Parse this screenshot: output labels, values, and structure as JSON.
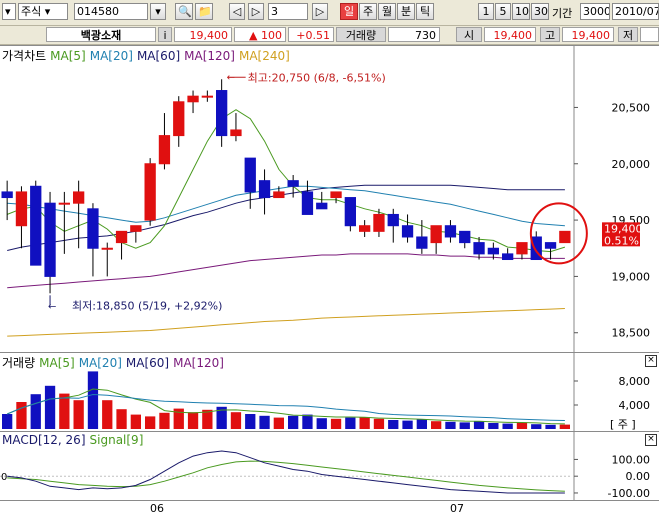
{
  "toolbar": {
    "market": "주식",
    "code": "014580",
    "count": "3",
    "periods": [
      "일",
      "주",
      "월",
      "분",
      "틱"
    ],
    "nums": [
      "1",
      "5",
      "10",
      "30"
    ],
    "period_label": "기간",
    "period_value": "3000",
    "date": "2010/07/"
  },
  "info": {
    "name": "백광소재",
    "i": "i",
    "price": "19,400",
    "change": "▲ 100",
    "rate": "+0.51",
    "vol_label": "거래량",
    "vol_value": "730",
    "open_label": "시",
    "open_value": "19,400",
    "high_label": "고",
    "high_value": "19,400",
    "low_label": "저"
  },
  "price_pane": {
    "title": "가격차트",
    "mas": [
      {
        "label": "MA[5]",
        "color": "#4a9a20"
      },
      {
        "label": "MA[20]",
        "color": "#2080b0"
      },
      {
        "label": "MA[60]",
        "color": "#1a1a6a"
      },
      {
        "label": "MA[120]",
        "color": "#7a1a7a"
      },
      {
        "label": "MA[240]",
        "color": "#d0a020"
      }
    ],
    "y_ticks": [
      "20,500",
      "20,000",
      "19,500",
      "19,000",
      "18,500"
    ],
    "high_note": "최고:20,750 (6/8, -6,51%)",
    "low_note": "최저:18,850 (5/19, +2,92%)",
    "last_price": "19,400",
    "last_rate": "0.51%"
  },
  "volume_pane": {
    "title": "거래량",
    "mas": [
      {
        "label": "MA[5]",
        "color": "#4a9a20"
      },
      {
        "label": "MA[20]",
        "color": "#2080b0"
      },
      {
        "label": "MA[60]",
        "color": "#1a1a6a"
      },
      {
        "label": "MA[120]",
        "color": "#7a1a7a"
      }
    ],
    "y_ticks": [
      "8,000",
      "4,000"
    ],
    "unit": "[ 주 ]"
  },
  "macd_pane": {
    "title": "MACD[12, 26]",
    "signal": "Signal[9]",
    "left_tick": "0",
    "y_ticks": [
      "100.00",
      "0.00",
      "-100.00"
    ]
  },
  "x_axis": {
    "labels": [
      "06",
      "07"
    ]
  },
  "colors": {
    "up": "#e01010",
    "down": "#1010c0"
  },
  "chart_data": {
    "type": "candlestick",
    "candles": [
      {
        "o": 19750,
        "h": 19850,
        "l": 19500,
        "c": 19700
      },
      {
        "o": 19450,
        "h": 19800,
        "l": 19250,
        "c": 19750
      },
      {
        "o": 19800,
        "h": 19850,
        "l": 19150,
        "c": 19100
      },
      {
        "o": 19650,
        "h": 19750,
        "l": 18850,
        "c": 19000
      },
      {
        "o": 19650,
        "h": 19750,
        "l": 19200,
        "c": 19650
      },
      {
        "o": 19650,
        "h": 19850,
        "l": 19250,
        "c": 19750
      },
      {
        "o": 19600,
        "h": 19650,
        "l": 19000,
        "c": 19250
      },
      {
        "o": 19250,
        "h": 19300,
        "l": 19000,
        "c": 19250
      },
      {
        "o": 19300,
        "h": 19400,
        "l": 19150,
        "c": 19400
      },
      {
        "o": 19400,
        "h": 19450,
        "l": 19300,
        "c": 19450
      },
      {
        "o": 19500,
        "h": 20050,
        "l": 19450,
        "c": 20000
      },
      {
        "o": 20000,
        "h": 20450,
        "l": 19950,
        "c": 20250
      },
      {
        "o": 20250,
        "h": 20600,
        "l": 20150,
        "c": 20550
      },
      {
        "o": 20550,
        "h": 20650,
        "l": 20450,
        "c": 20600
      },
      {
        "o": 20600,
        "h": 20650,
        "l": 20550,
        "c": 20600
      },
      {
        "o": 20650,
        "h": 20750,
        "l": 20150,
        "c": 20250
      },
      {
        "o": 20250,
        "h": 20450,
        "l": 20200,
        "c": 20300
      },
      {
        "o": 20050,
        "h": 20050,
        "l": 19600,
        "c": 19750
      },
      {
        "o": 19850,
        "h": 19950,
        "l": 19550,
        "c": 19700
      },
      {
        "o": 19700,
        "h": 19800,
        "l": 19700,
        "c": 19750
      },
      {
        "o": 19850,
        "h": 19900,
        "l": 19700,
        "c": 19800
      },
      {
        "o": 19750,
        "h": 19850,
        "l": 19550,
        "c": 19550
      },
      {
        "o": 19650,
        "h": 19750,
        "l": 19600,
        "c": 19600
      },
      {
        "o": 19700,
        "h": 19750,
        "l": 19650,
        "c": 19750
      },
      {
        "o": 19700,
        "h": 19700,
        "l": 19400,
        "c": 19450
      },
      {
        "o": 19400,
        "h": 19500,
        "l": 19350,
        "c": 19450
      },
      {
        "o": 19400,
        "h": 19600,
        "l": 19350,
        "c": 19550
      },
      {
        "o": 19550,
        "h": 19600,
        "l": 19300,
        "c": 19450
      },
      {
        "o": 19450,
        "h": 19550,
        "l": 19300,
        "c": 19350
      },
      {
        "o": 19350,
        "h": 19500,
        "l": 19200,
        "c": 19250
      },
      {
        "o": 19300,
        "h": 19450,
        "l": 19200,
        "c": 19450
      },
      {
        "o": 19450,
        "h": 19500,
        "l": 19300,
        "c": 19350
      },
      {
        "o": 19400,
        "h": 19400,
        "l": 19250,
        "c": 19300
      },
      {
        "o": 19300,
        "h": 19350,
        "l": 19150,
        "c": 19200
      },
      {
        "o": 19250,
        "h": 19300,
        "l": 19150,
        "c": 19200
      },
      {
        "o": 19200,
        "h": 19250,
        "l": 19150,
        "c": 19150
      },
      {
        "o": 19200,
        "h": 19300,
        "l": 19150,
        "c": 19300
      },
      {
        "o": 19350,
        "h": 19400,
        "l": 19150,
        "c": 19150
      },
      {
        "o": 19300,
        "h": 19300,
        "l": 19150,
        "c": 19250
      },
      {
        "o": 19300,
        "h": 19400,
        "l": 19300,
        "c": 19400
      }
    ],
    "volume": [
      2500,
      4500,
      5800,
      7200,
      5900,
      4800,
      9600,
      4800,
      3300,
      2400,
      2100,
      2700,
      3400,
      2800,
      3200,
      3700,
      2800,
      2500,
      2200,
      1900,
      2200,
      2400,
      1800,
      1700,
      1900,
      2000,
      1700,
      1500,
      1400,
      1600,
      1300,
      1200,
      1100,
      1300,
      1000,
      900,
      1100,
      800,
      700,
      730
    ],
    "ma5": [
      19550,
      19600,
      19620,
      19480,
      19400,
      19450,
      19500,
      19420,
      19300,
      19250,
      19300,
      19450,
      19700,
      19950,
      20200,
      20400,
      20480,
      20400,
      20200,
      19950,
      19800,
      19700,
      19680,
      19680,
      19640,
      19600,
      19570,
      19530,
      19480,
      19450,
      19400,
      19390,
      19360,
      19330,
      19320,
      19260,
      19250,
      19230,
      19220,
      19260
    ],
    "ma20": [
      19650,
      19640,
      19620,
      19600,
      19580,
      19560,
      19540,
      19520,
      19500,
      19480,
      19490,
      19520,
      19560,
      19600,
      19640,
      19680,
      19720,
      19740,
      19760,
      19780,
      19800,
      19800,
      19790,
      19780,
      19770,
      19760,
      19740,
      19720,
      19700,
      19680,
      19660,
      19640,
      19610,
      19580,
      19550,
      19520,
      19490,
      19470,
      19460,
      19450
    ],
    "ma60": [
      19230,
      19260,
      19280,
      19300,
      19320,
      19340,
      19350,
      19360,
      19380,
      19400,
      19430,
      19460,
      19500,
      19540,
      19570,
      19610,
      19650,
      19680,
      19700,
      19720,
      19740,
      19760,
      19780,
      19790,
      19800,
      19810,
      19810,
      19810,
      19810,
      19810,
      19810,
      19810,
      19800,
      19790,
      19780,
      19770,
      19770,
      19770,
      19770,
      19770
    ],
    "ma120": [
      18900,
      18910,
      18920,
      18930,
      18940,
      18950,
      18960,
      18970,
      18980,
      18990,
      19000,
      19020,
      19040,
      19060,
      19080,
      19100,
      19120,
      19140,
      19150,
      19160,
      19170,
      19180,
      19190,
      19190,
      19200,
      19200,
      19200,
      19200,
      19200,
      19190,
      19190,
      19180,
      19180,
      19170,
      19170,
      19160,
      19160,
      19160,
      19160,
      19160
    ],
    "ma240": [
      18470,
      18475,
      18480,
      18485,
      18490,
      18495,
      18500,
      18505,
      18510,
      18515,
      18520,
      18530,
      18540,
      18550,
      18560,
      18570,
      18580,
      18590,
      18600,
      18605,
      18610,
      18620,
      18630,
      18635,
      18640,
      18645,
      18650,
      18655,
      18660,
      18665,
      18670,
      18675,
      18680,
      18685,
      18690,
      18695,
      18700,
      18705,
      18710,
      18715
    ],
    "macd": [
      0,
      -10,
      -30,
      -60,
      -70,
      -80,
      -70,
      -75,
      -70,
      -55,
      -20,
      30,
      80,
      120,
      140,
      150,
      140,
      110,
      80,
      60,
      40,
      30,
      10,
      0,
      -10,
      -20,
      -30,
      -40,
      -50,
      -60,
      -70,
      -80,
      -85,
      -90,
      -95,
      -100,
      -100,
      -100,
      -100,
      -100
    ],
    "signal": [
      -10,
      -15,
      -20,
      -30,
      -40,
      -50,
      -55,
      -60,
      -62,
      -60,
      -50,
      -30,
      -5,
      20,
      50,
      70,
      85,
      90,
      88,
      82,
      75,
      65,
      55,
      45,
      35,
      25,
      15,
      5,
      -5,
      -15,
      -25,
      -35,
      -45,
      -55,
      -62,
      -70,
      -76,
      -82,
      -86,
      -90
    ],
    "y_range": [
      18400,
      20850
    ],
    "vol_range": [
      0,
      10000
    ],
    "macd_range": [
      -130,
      180
    ]
  }
}
